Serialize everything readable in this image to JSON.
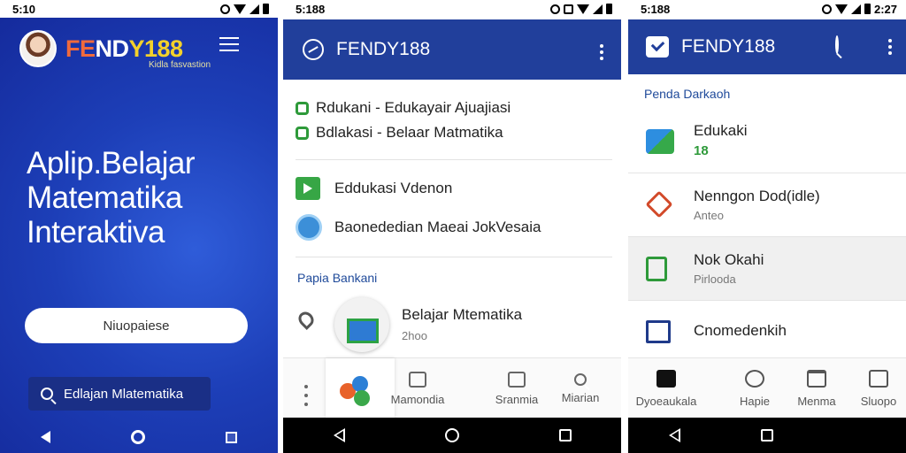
{
  "phone1": {
    "status_time": "5:10",
    "logo_part1": "FE",
    "logo_part2": "ND",
    "logo_part3": "Y188",
    "sublogo": "Kidla fasvastion",
    "hero_line1": "Aplip.Belajar",
    "hero_line2": "Matematika",
    "hero_line3": "Interaktiva",
    "primary_button": "Niuopaiese",
    "search_button": "Edlajan Mlatematika"
  },
  "phone2": {
    "status_time": "5:188",
    "title": "FENDY188",
    "row1": "Rdukani - Edukayair Ajuajiasi",
    "row2": "Bdlakasi - Belaar Matmatika",
    "row3": "Eddukasi Vdenon",
    "row4": "Baonededian Maeai JokVesaia",
    "section": "Papia Bankani",
    "item_title": "Belajar Mtematika",
    "item_sub": "2hoo",
    "tabs": [
      "Mamondia",
      "Sranmia",
      "Miarian"
    ]
  },
  "phone3": {
    "status_time": "5:188",
    "status_time_right": "2:27",
    "title": "FENDY188",
    "section": "Penda Darkaoh",
    "rows": [
      {
        "title": "Edukaki",
        "sub": "18"
      },
      {
        "title": "Nenngon Dod(idle)",
        "sub": "Anteo"
      },
      {
        "title": "Nok Okahi",
        "sub": "Pirlooda"
      },
      {
        "title": "Cnomedenkih",
        "sub": ""
      }
    ],
    "tabs": [
      "Dyoeaukala",
      "Hapie",
      "Menma",
      "Sluopo"
    ]
  },
  "colors": {
    "primary_blue": "#213f9b",
    "green_accent": "#2e9a3a",
    "orange_accent": "#f06a3c"
  }
}
